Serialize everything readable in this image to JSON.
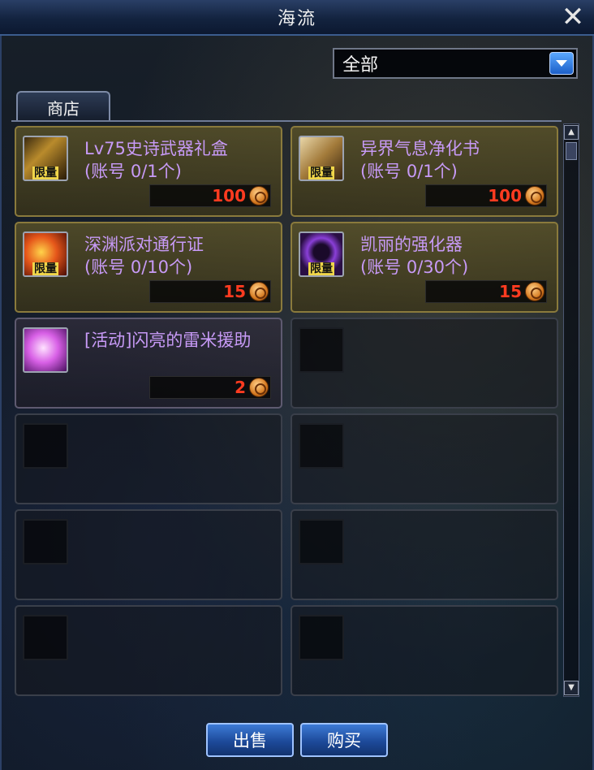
{
  "window": {
    "title": "海流"
  },
  "filter": {
    "selected": "全部"
  },
  "tabs": [
    {
      "label": "商店"
    }
  ],
  "items": [
    {
      "name": "Lv75史诗武器礼盒",
      "limit": "(账号 0/1个)",
      "price": "100",
      "badge": "限量",
      "icon": "gold-chest-icon"
    },
    {
      "name": "异界气息净化书",
      "limit": "(账号 0/1个)",
      "price": "100",
      "badge": "限量",
      "icon": "scroll-book-icon"
    },
    {
      "name": "深渊派对通行证",
      "limit": "(账号 0/10个)",
      "price": "15",
      "badge": "限量",
      "icon": "flame-pass-icon"
    },
    {
      "name": "凯丽的强化器",
      "limit": "(账号 0/30个)",
      "price": "15",
      "badge": "限量",
      "icon": "purple-orb-icon"
    },
    {
      "name": "[活动]闪亮的雷米援助",
      "limit": "",
      "price": "2",
      "badge": "",
      "icon": "pink-crystal-icon"
    }
  ],
  "buttons": {
    "sell": "出售",
    "buy": "购买"
  },
  "colors": {
    "item_name": "#c79af6",
    "price": "#ff3b20",
    "title_bar": "#13233f"
  }
}
